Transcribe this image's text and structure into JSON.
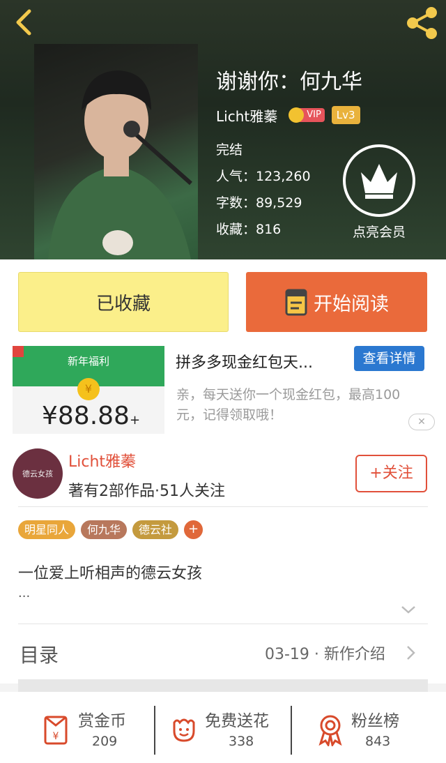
{
  "header": {
    "title": "谢谢你：何九华",
    "author": "Licht雅蓁",
    "vip_badge": "VIP",
    "level_badge": "Lv3",
    "status": "完结",
    "popularity": "人气：123,260",
    "word_count": "字数：89,529",
    "favorites": "收藏：816",
    "vip_member_label": "点亮会员"
  },
  "actions": {
    "favorited_label": "已收藏",
    "read_label": "开始阅读"
  },
  "ad": {
    "image_title": "新年福利",
    "image_amount": "¥88.88",
    "image_amount_sup": "+",
    "title": "拼多多现金红包天...",
    "cta": "查看详情",
    "description": "亲，每天送你一个现金红包，最高100元，记得领取哦！",
    "close": "✕"
  },
  "author_card": {
    "avatar_text": "德云女孩",
    "name": "Licht雅蓁",
    "subtitle": "著有2部作品·51人关注",
    "follow_label": "+关注"
  },
  "tags": [
    {
      "label": "明星同人",
      "color": "#e9a63a"
    },
    {
      "label": "何九华",
      "color": "#b8785c"
    },
    {
      "label": "德云社",
      "color": "#c49a3e"
    }
  ],
  "tag_add": "+",
  "intro": {
    "text": "一位爱上听相声的德云女孩",
    "ellipsis": "..."
  },
  "toc": {
    "label": "目录",
    "latest": "03-19 · 新作介绍"
  },
  "bottom": {
    "reward": {
      "label": "赏金币",
      "count": "209"
    },
    "flowers": {
      "label": "免费送花",
      "count": "338"
    },
    "fans": {
      "label": "粉丝榜",
      "count": "843"
    }
  },
  "colors": {
    "accent": "#e1503a",
    "read_button": "#ea6a3b",
    "favorite_button": "#fbef8a",
    "ad_cta": "#2b78d0"
  }
}
